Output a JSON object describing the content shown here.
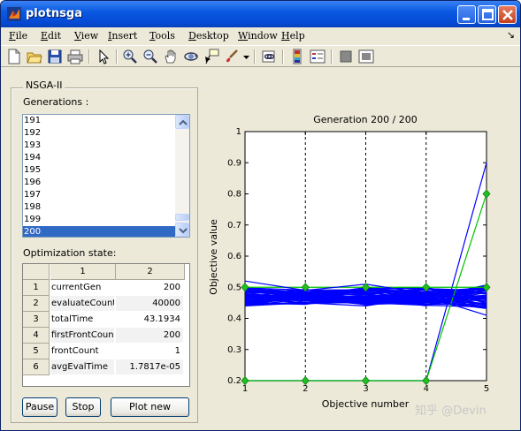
{
  "window": {
    "title": "plotnsga"
  },
  "menu": [
    {
      "label": "File",
      "accel": "F",
      "rest": "ile"
    },
    {
      "label": "Edit",
      "accel": "E",
      "rest": "dit"
    },
    {
      "label": "View",
      "accel": "V",
      "rest": "iew"
    },
    {
      "label": "Insert",
      "accel": "I",
      "rest": "nsert"
    },
    {
      "label": "Tools",
      "accel": "T",
      "rest": "ools"
    },
    {
      "label": "Desktop",
      "accel": "D",
      "rest": "esktop"
    },
    {
      "label": "Window",
      "accel": "W",
      "rest": "indow"
    },
    {
      "label": "Help",
      "accel": "H",
      "rest": "elp"
    }
  ],
  "toolbar_icons": [
    "new-figure-icon",
    "open-file-icon",
    "save-icon",
    "print-icon",
    "pointer-icon",
    "zoom-in-icon",
    "zoom-out-icon",
    "pan-hand-icon",
    "rotate-3d-icon",
    "data-cursor-icon",
    "brush-icon",
    "dropdown-icon",
    "link-plot-icon",
    "colorbar-icon",
    "legend-icon",
    "hide-plot-tools-icon",
    "show-plot-tools-icon"
  ],
  "panel": {
    "title": "NSGA-II",
    "generations_label": "Generations :",
    "generations": [
      "191",
      "192",
      "193",
      "194",
      "195",
      "196",
      "197",
      "198",
      "199",
      "200"
    ],
    "selected_generation": "200",
    "state_label": "Optimization state:",
    "table_headers": [
      "1",
      "2"
    ],
    "table_rows": [
      {
        "index": "1",
        "name": "currentGen",
        "value": "200"
      },
      {
        "index": "2",
        "name": "evaluateCount",
        "value": "40000"
      },
      {
        "index": "3",
        "name": "totalTime",
        "value": "43.1934"
      },
      {
        "index": "4",
        "name": "firstFrontCount",
        "value": "200"
      },
      {
        "index": "5",
        "name": "frontCount",
        "value": "1"
      },
      {
        "index": "6",
        "name": "avgEvalTime",
        "value": "1.7817e-05"
      }
    ],
    "buttons": {
      "pause": "Pause",
      "stop": "Stop",
      "plot_new": "Plot new"
    }
  },
  "chart_data": {
    "type": "line",
    "title": "Generation 200 / 200",
    "xlabel": "Objective number",
    "ylabel": "Objective value",
    "xlim": [
      1,
      5
    ],
    "ylim": [
      0.2,
      1
    ],
    "x_ticks": [
      "1",
      "2",
      "3",
      "4",
      "5"
    ],
    "y_ticks": [
      "0.2",
      "0.3",
      "0.4",
      "0.5",
      "0.6",
      "0.7",
      "0.8",
      "0.9",
      "1"
    ],
    "x": [
      1,
      2,
      3,
      4,
      5
    ],
    "vertical_dashed_lines_at": [
      2,
      3,
      4
    ],
    "series": [
      {
        "values": [
          0.2,
          0.2,
          0.2,
          0.2,
          0.9
        ],
        "color": "#0000ff"
      },
      {
        "values": [
          0.2,
          0.2,
          0.2,
          0.2,
          0.8
        ],
        "color": "#00c000",
        "marker": "diamond"
      },
      {
        "values": [
          0.5,
          0.5,
          0.5,
          0.5,
          0.5
        ],
        "color": "#00c000",
        "marker": "diamond"
      },
      {
        "values": [
          0.52,
          0.49,
          0.51,
          0.48,
          0.46
        ],
        "color": "#0000ff"
      },
      {
        "values": [
          0.44,
          0.45,
          0.44,
          0.47,
          0.41
        ],
        "color": "#0000ff"
      }
    ],
    "band": {
      "center": [
        0.47,
        0.47,
        0.47,
        0.47,
        0.47
      ],
      "spread": [
        0.03,
        0.025,
        0.03,
        0.03,
        0.04
      ],
      "count": 60,
      "color": "#0000ff"
    }
  },
  "watermark": "知乎 @Devin"
}
